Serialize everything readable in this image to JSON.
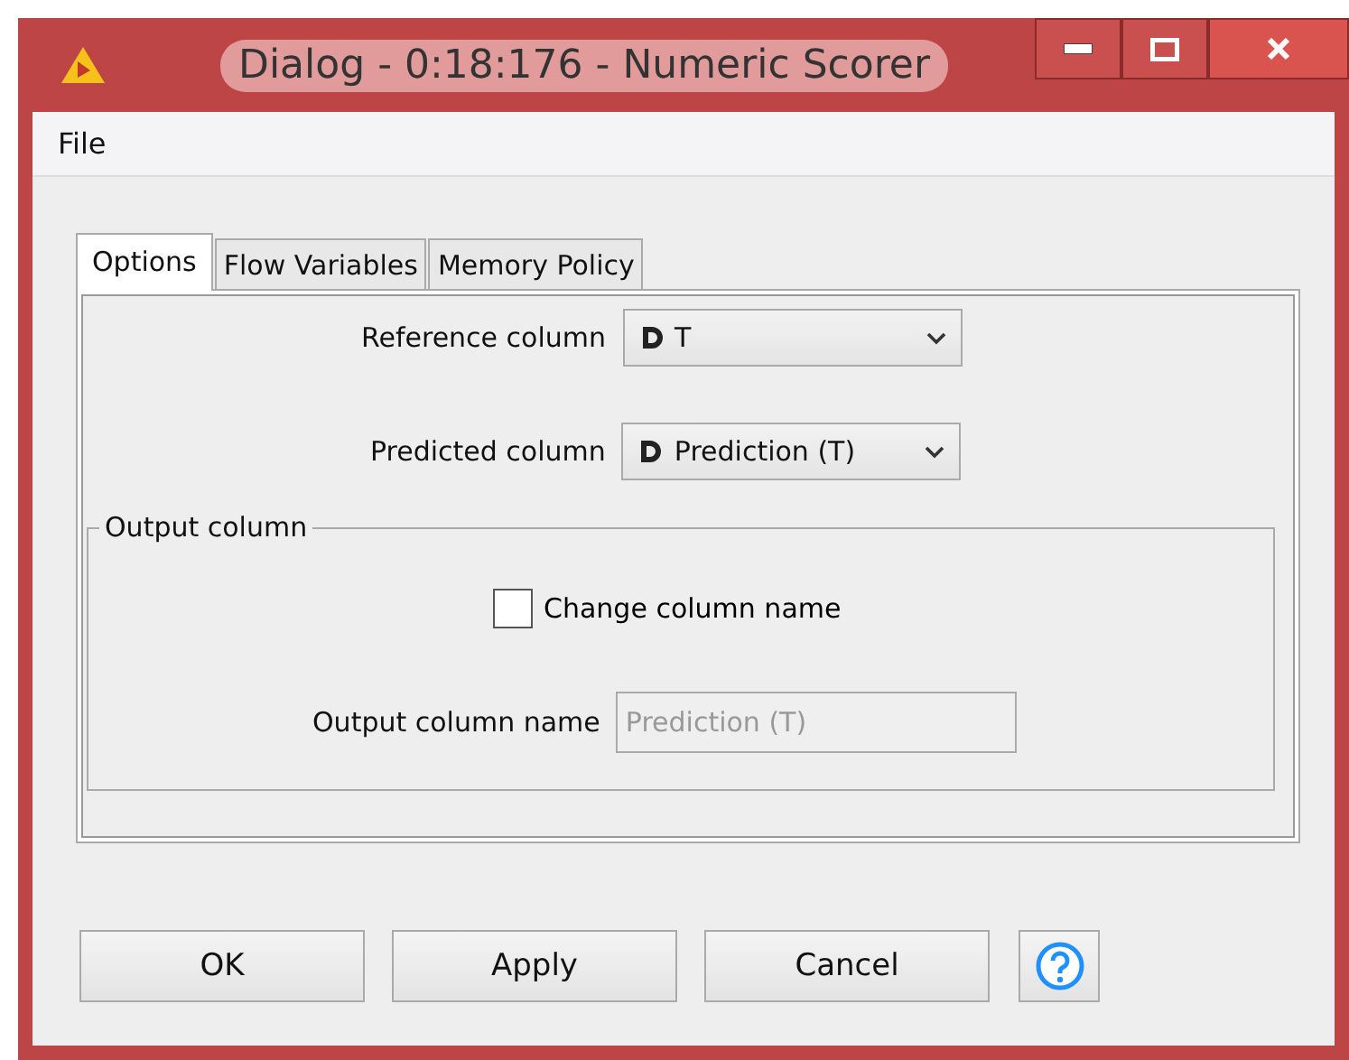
{
  "window": {
    "title": "Dialog - 0:18:176 - Numeric Scorer"
  },
  "menu": [
    "File"
  ],
  "tabs": [
    {
      "label": "Options",
      "selected": true
    },
    {
      "label": "Flow Variables",
      "selected": false
    },
    {
      "label": "Memory Policy",
      "selected": false
    }
  ],
  "reference_column": {
    "label": "Reference column",
    "value": "T"
  },
  "predicted_column": {
    "label": "Predicted column",
    "value": "Prediction (T)"
  },
  "output_column": {
    "title": "Output column",
    "change_name": {
      "label": "Change column name",
      "checked": false
    },
    "name_field": {
      "label": "Output column name",
      "placeholder": "Prediction (T)",
      "disabled": true
    }
  },
  "buttons": [
    "OK",
    "Apply",
    "Cancel"
  ]
}
